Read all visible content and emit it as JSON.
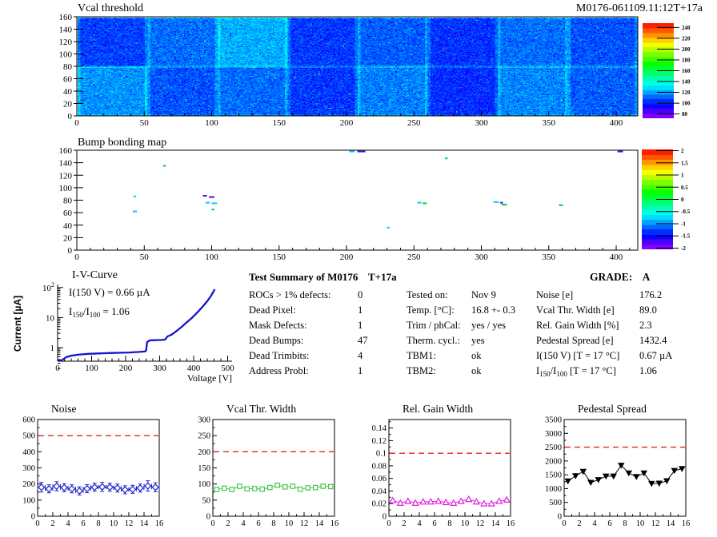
{
  "summary": {
    "title_left": "Test Summary of M0176",
    "title_mid": "T+17a",
    "grade_label": "GRADE:",
    "grade": "A",
    "col1": [
      {
        "label": "ROCs > 1% defects:",
        "value": "0"
      },
      {
        "label": "Dead Pixel:",
        "value": "1"
      },
      {
        "label": "Mask Defects:",
        "value": "1"
      },
      {
        "label": "Dead Bumps:",
        "value": "47"
      },
      {
        "label": "Dead Trimbits:",
        "value": "4"
      },
      {
        "label": "Address Probl:",
        "value": "1"
      }
    ],
    "col2": [
      {
        "label": "Tested on:",
        "value": "Nov 9"
      },
      {
        "label": "Temp. [°C]:",
        "value": "16.8 +- 0.3"
      },
      {
        "label": "Trim / phCal:",
        "value": "yes / yes"
      },
      {
        "label": "Therm. cycl.:",
        "value": "yes"
      },
      {
        "label": "TBM1:",
        "value": "ok"
      },
      {
        "label": "TBM2:",
        "value": "ok"
      }
    ],
    "col3": [
      {
        "label": "Noise [e]",
        "value": "176.2"
      },
      {
        "label": "Vcal Thr. Width [e]",
        "value": "89.0"
      },
      {
        "label": "Rel. Gain Width [%]",
        "value": "2.3"
      },
      {
        "label": "Pedestal Spread [e]",
        "value": "1432.4"
      },
      {
        "label": "I(150 V) [T = 17 °C]",
        "value": "0.67 µA"
      },
      {
        "parts": [
          {
            "t": "I"
          },
          {
            "t": "150",
            "sub": true
          },
          {
            "t": "/I"
          },
          {
            "t": "100",
            "sub": true
          },
          {
            "t": "  [T = 17 °C]"
          }
        ],
        "value": "1.06"
      }
    ]
  },
  "chart_data": [
    {
      "id": "vcal_map",
      "type": "heatmap",
      "title": "Vcal threshold",
      "right_title": "M0176-061109.11:12T+17a",
      "xlim": [
        0,
        416
      ],
      "ylim": [
        0,
        160
      ],
      "xticks": [
        0,
        50,
        100,
        150,
        200,
        250,
        300,
        350,
        400
      ],
      "yticks": [
        0,
        20,
        40,
        60,
        80,
        100,
        120,
        140,
        160
      ],
      "roc_cols": 8,
      "roc_rows": 2,
      "roc_base_top": [
        105,
        112,
        122,
        104,
        110,
        103,
        112,
        108
      ],
      "roc_base_bottom": [
        118,
        108,
        112,
        104,
        115,
        102,
        116,
        110
      ],
      "noise_sigma": 9,
      "edge_boost": 9,
      "colorbar": {
        "vmin": 72,
        "vmax": 248,
        "ticks": [
          240,
          220,
          200,
          180,
          160,
          140,
          120,
          100,
          80
        ]
      }
    },
    {
      "id": "bump_map",
      "type": "scatter",
      "title": "Bump bonding map",
      "xlim": [
        0,
        416
      ],
      "ylim": [
        0,
        160
      ],
      "xticks": [
        0,
        50,
        100,
        150,
        200,
        250,
        300,
        350,
        400
      ],
      "yticks": [
        0,
        20,
        40,
        60,
        80,
        100,
        120,
        140,
        160
      ],
      "defects": [
        {
          "x": 43,
          "y": 86,
          "w": 2,
          "c": "#00ccff"
        },
        {
          "x": 43,
          "y": 62,
          "w": 3,
          "c": "#00ccff"
        },
        {
          "x": 65,
          "y": 135,
          "w": 2,
          "c": "#00cc44"
        },
        {
          "x": 95,
          "y": 87,
          "w": 3,
          "c": "#4411dd"
        },
        {
          "x": 100,
          "y": 85,
          "w": 4,
          "c": "#4411dd"
        },
        {
          "x": 97,
          "y": 76,
          "w": 3,
          "c": "#00ccff"
        },
        {
          "x": 102,
          "y": 75,
          "w": 4,
          "c": "#00ccff"
        },
        {
          "x": 101,
          "y": 65,
          "w": 2,
          "c": "#00cc44"
        },
        {
          "x": 204,
          "y": 158,
          "w": 4,
          "c": "#00ccff"
        },
        {
          "x": 211,
          "y": 158,
          "w": 6,
          "c": "#4411dd"
        },
        {
          "x": 231,
          "y": 36,
          "w": 2,
          "c": "#00ccff"
        },
        {
          "x": 254,
          "y": 76,
          "w": 3,
          "c": "#00ccff"
        },
        {
          "x": 258,
          "y": 75,
          "w": 3,
          "c": "#00cc44"
        },
        {
          "x": 274,
          "y": 147,
          "w": 2,
          "c": "#00cc44"
        },
        {
          "x": 311,
          "y": 77,
          "w": 4,
          "c": "#00ccff"
        },
        {
          "x": 315,
          "y": 76,
          "w": 2,
          "c": "#4411dd"
        },
        {
          "x": 317,
          "y": 73,
          "w": 4,
          "c": "#00cc44"
        },
        {
          "x": 359,
          "y": 72,
          "w": 3,
          "c": "#00cc44"
        },
        {
          "x": 403,
          "y": 158,
          "w": 4,
          "c": "#4411dd"
        }
      ],
      "colorbar": {
        "vmin": -2.05,
        "vmax": 2.05,
        "ticks": [
          2,
          1.5,
          1,
          0.5,
          0,
          -0.5,
          -1,
          -1.5,
          -2
        ]
      }
    },
    {
      "id": "iv_curve",
      "type": "line",
      "title": "I-V-Curve",
      "xlabel": "Voltage [V]",
      "ylabel": "Current [µA]",
      "ann1": "I(150 V) = 0.66 µA",
      "ann2_parts": [
        {
          "t": "I"
        },
        {
          "t": "150",
          "sub": true
        },
        {
          "t": "/I"
        },
        {
          "t": "100",
          "sub": true
        },
        {
          "t": " =  1.06"
        }
      ],
      "xticks": [
        0,
        100,
        200,
        300,
        400,
        500
      ],
      "ydecades": [
        {
          "v": 1,
          "l": "1"
        },
        {
          "v": 10,
          "l": "10"
        },
        {
          "v": 100,
          "l": "10",
          "sup": "2"
        }
      ],
      "xlim": [
        0,
        512
      ],
      "ylim_log": [
        0.16,
        100
      ],
      "color": "#1313cc",
      "points": [
        [
          1,
          0.16
        ],
        [
          4,
          0.22
        ],
        [
          8,
          0.3
        ],
        [
          15,
          0.4
        ],
        [
          25,
          0.48
        ],
        [
          40,
          0.54
        ],
        [
          60,
          0.58
        ],
        [
          90,
          0.62
        ],
        [
          120,
          0.64
        ],
        [
          150,
          0.66
        ],
        [
          180,
          0.67
        ],
        [
          210,
          0.69
        ],
        [
          240,
          0.72
        ],
        [
          255,
          0.74
        ],
        [
          260,
          0.78
        ],
        [
          263,
          1.5
        ],
        [
          268,
          1.68
        ],
        [
          275,
          1.76
        ],
        [
          290,
          1.78
        ],
        [
          305,
          1.8
        ],
        [
          315,
          1.83
        ],
        [
          319,
          2.05
        ],
        [
          323,
          2.35
        ],
        [
          335,
          2.7
        ],
        [
          350,
          3.6
        ],
        [
          365,
          4.9
        ],
        [
          380,
          7.0
        ],
        [
          395,
          9.8
        ],
        [
          410,
          14.5
        ],
        [
          425,
          22
        ],
        [
          440,
          35
        ],
        [
          452,
          55
        ],
        [
          462,
          88
        ]
      ]
    },
    {
      "id": "noise",
      "type": "line",
      "title": "Noise",
      "x": [
        0.5,
        1.5,
        2.5,
        3.5,
        4.5,
        5.5,
        6.5,
        7.5,
        8.5,
        9.5,
        10.5,
        11.5,
        12.5,
        13.5,
        14.5,
        15.5
      ],
      "values": [
        180,
        170,
        186,
        177,
        170,
        157,
        171,
        180,
        182,
        180,
        175,
        164,
        167,
        175,
        188,
        180
      ],
      "errors": [
        30,
        25,
        28,
        25,
        25,
        25,
        25,
        25,
        28,
        25,
        25,
        25,
        25,
        25,
        32,
        28
      ],
      "ymax": 600,
      "ytick_vals": [
        0,
        100,
        200,
        300,
        400,
        500,
        600
      ],
      "ytick_labels": [
        "0",
        "100",
        "200",
        "300",
        "400",
        "500",
        "600"
      ],
      "xticks": [
        0,
        2,
        4,
        6,
        8,
        10,
        12,
        14,
        16
      ],
      "threshold": 500,
      "threshold_color": "#e82020",
      "marker": "diamond",
      "color": "#2020c8"
    },
    {
      "id": "vcal_thr_width",
      "type": "line",
      "title": "Vcal Thr. Width",
      "x": [
        0.5,
        1.5,
        2.5,
        3.5,
        4.5,
        5.5,
        6.5,
        7.5,
        8.5,
        9.5,
        10.5,
        11.5,
        12.5,
        13.5,
        14.5,
        15.5
      ],
      "values": [
        83,
        87,
        83,
        93,
        85,
        86,
        84,
        89,
        96,
        91,
        93,
        84,
        88,
        89,
        93,
        92
      ],
      "ymax": 300,
      "ytick_vals": [
        0,
        50,
        100,
        150,
        200,
        250,
        300
      ],
      "ytick_labels": [
        "0",
        "50",
        "100",
        "150",
        "200",
        "250",
        "300"
      ],
      "xticks": [
        0,
        2,
        4,
        6,
        8,
        10,
        12,
        14,
        16
      ],
      "threshold": 200,
      "threshold_color": "#e82020",
      "marker": "square",
      "color": "#44c848"
    },
    {
      "id": "rel_gain_width",
      "type": "line",
      "title": "Rel. Gain Width",
      "x": [
        0.5,
        1.5,
        2.5,
        3.5,
        4.5,
        5.5,
        6.5,
        7.5,
        8.5,
        9.5,
        10.5,
        11.5,
        12.5,
        13.5,
        14.5,
        15.5
      ],
      "values": [
        0.025,
        0.021,
        0.024,
        0.021,
        0.023,
        0.023,
        0.024,
        0.022,
        0.021,
        0.024,
        0.027,
        0.023,
        0.02,
        0.02,
        0.024,
        0.026
      ],
      "ymax": 0.1535,
      "ytick_vals": [
        0,
        0.02,
        0.04,
        0.06,
        0.08,
        0.1,
        0.12,
        0.14
      ],
      "ytick_labels": [
        "0",
        "0.02",
        "0.04",
        "0.06",
        "0.08",
        "0.1",
        "0.12",
        "0.14"
      ],
      "xticks": [
        0,
        2,
        4,
        6,
        8,
        10,
        12,
        14,
        16
      ],
      "threshold": 0.1,
      "threshold_color": "#e82020",
      "marker": "triangle-open",
      "color": "#e020e0"
    },
    {
      "id": "pedestal_spread",
      "type": "line",
      "title": "Pedestal Spread",
      "x": [
        0.5,
        1.5,
        2.5,
        3.5,
        4.5,
        5.5,
        6.5,
        7.5,
        8.5,
        9.5,
        10.5,
        11.5,
        12.5,
        13.5,
        14.5,
        15.5
      ],
      "values": [
        1270,
        1460,
        1620,
        1220,
        1320,
        1450,
        1450,
        1840,
        1560,
        1430,
        1560,
        1180,
        1190,
        1280,
        1650,
        1720
      ],
      "ymax": 3500,
      "ytick_vals": [
        0,
        500,
        1000,
        1500,
        2000,
        2500,
        3000,
        3500
      ],
      "ytick_labels": [
        "0",
        "500",
        "1000",
        "1500",
        "2000",
        "2500",
        "3000",
        "3500"
      ],
      "xticks": [
        0,
        2,
        4,
        6,
        8,
        10,
        12,
        14,
        16
      ],
      "threshold": 2500,
      "threshold_color": "#e82020",
      "marker": "triangle-down-filled",
      "color": "#000000"
    }
  ]
}
